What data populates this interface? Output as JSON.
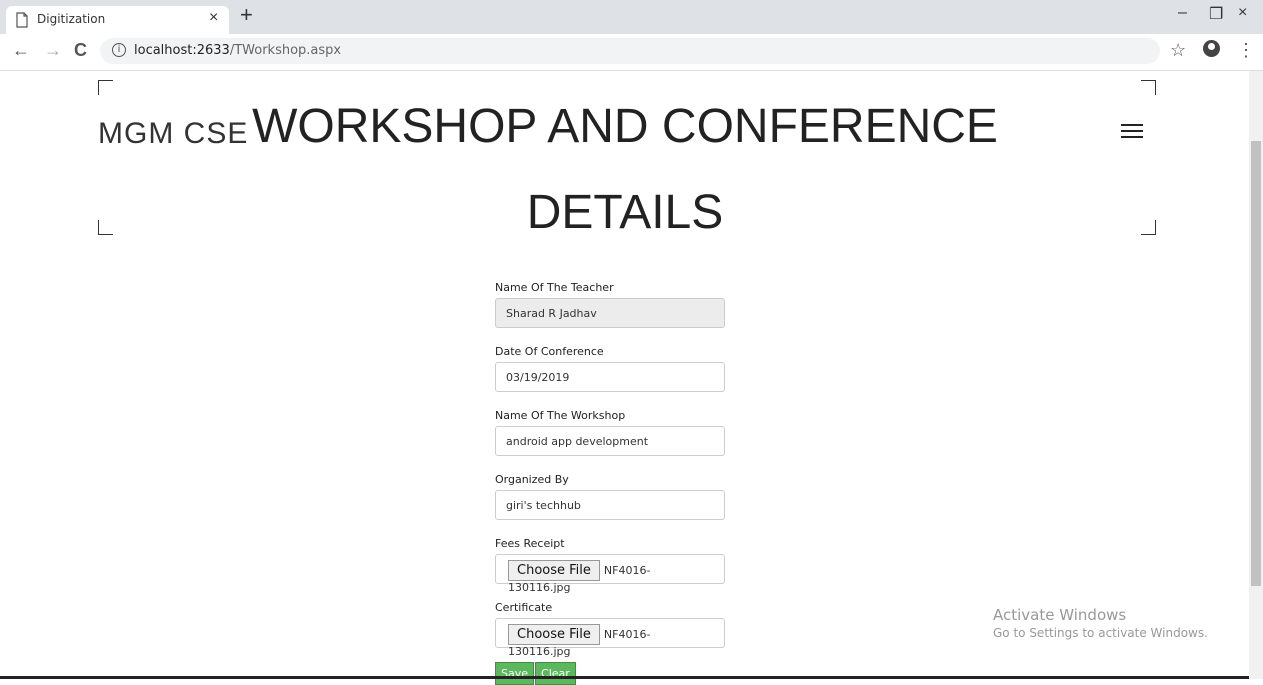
{
  "browser": {
    "tab_title": "Digitization",
    "tab_close": "×",
    "new_tab": "+",
    "minimize": "–",
    "restore": "❐",
    "close": "×",
    "back": "←",
    "forward": "→",
    "reload": "C",
    "url_host": "localhost:2633",
    "url_path": "/TWorkshop.aspx",
    "star": "☆",
    "menu": "⋮"
  },
  "header": {
    "brand": "MGM CSE",
    "title": "WORKSHOP AND CONFERENCE DETAILS"
  },
  "form": {
    "teacher_label": "Name Of The Teacher",
    "teacher_value": "Sharad R Jadhav",
    "date_label": "Date Of Conference",
    "date_value": "03/19/2019",
    "workshop_label": "Name Of The Workshop",
    "workshop_value": "android app development",
    "organized_label": "Organized By",
    "organized_value": "giri's techhub",
    "fees_label": "Fees Receipt",
    "fees_button": "Choose File",
    "fees_file": "NF4016-130116.jpg",
    "cert_label": "Certificate",
    "cert_button": "Choose File",
    "cert_file": "NF4016-130116.jpg",
    "save": "Save",
    "clear": "Clear"
  },
  "watermark": {
    "line1": "Activate Windows",
    "line2": "Go to Settings to activate Windows."
  }
}
